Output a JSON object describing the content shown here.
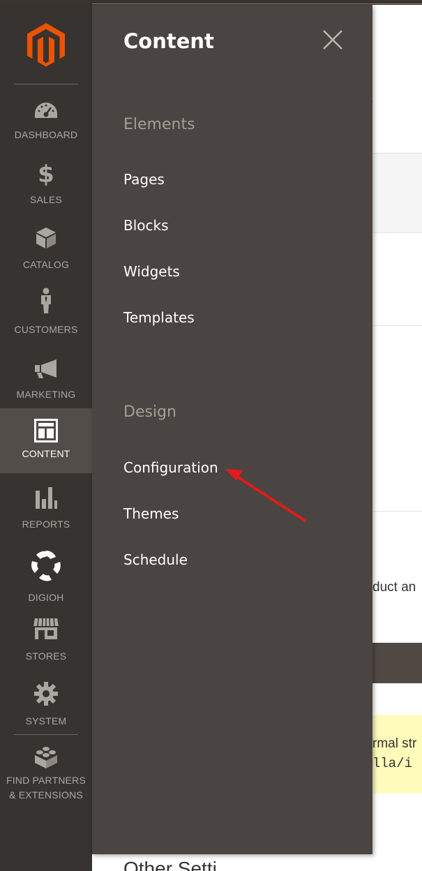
{
  "sidebar": {
    "items": [
      {
        "label": "DASHBOARD",
        "icon": "dashboard-gauge-icon"
      },
      {
        "label": "SALES",
        "icon": "dollar-icon"
      },
      {
        "label": "CATALOG",
        "icon": "box-icon"
      },
      {
        "label": "CUSTOMERS",
        "icon": "person-icon"
      },
      {
        "label": "MARKETING",
        "icon": "megaphone-icon"
      },
      {
        "label": "CONTENT",
        "icon": "layout-icon"
      },
      {
        "label": "REPORTS",
        "icon": "bar-chart-icon"
      },
      {
        "label": "DIGIOH",
        "icon": "digioh-logo-icon"
      },
      {
        "label": "STORES",
        "icon": "storefront-icon"
      },
      {
        "label": "SYSTEM",
        "icon": "gear-icon"
      },
      {
        "label_line1": "FIND PARTNERS",
        "label_line2": "& EXTENSIONS",
        "icon": "lego-brick-icon"
      }
    ],
    "active": "CONTENT"
  },
  "panel": {
    "title": "Content",
    "sections": [
      {
        "title": "Elements",
        "links": [
          "Pages",
          "Blocks",
          "Widgets",
          "Templates"
        ]
      },
      {
        "title": "Design",
        "links": [
          "Configuration",
          "Themes",
          "Schedule"
        ]
      }
    ]
  },
  "background": {
    "fragment_1": "duct an",
    "notice_line1": "rmal str",
    "notice_line2": "lla/i",
    "bottom_title": "Other Setti"
  },
  "colors": {
    "sidebar_bg": "#373330",
    "active_item_bg": "#524d49",
    "panel_bg": "#4a4542",
    "section_title": "#a79d95",
    "logo_orange": "#eb5202",
    "annotation_arrow": "#e31b1b"
  }
}
